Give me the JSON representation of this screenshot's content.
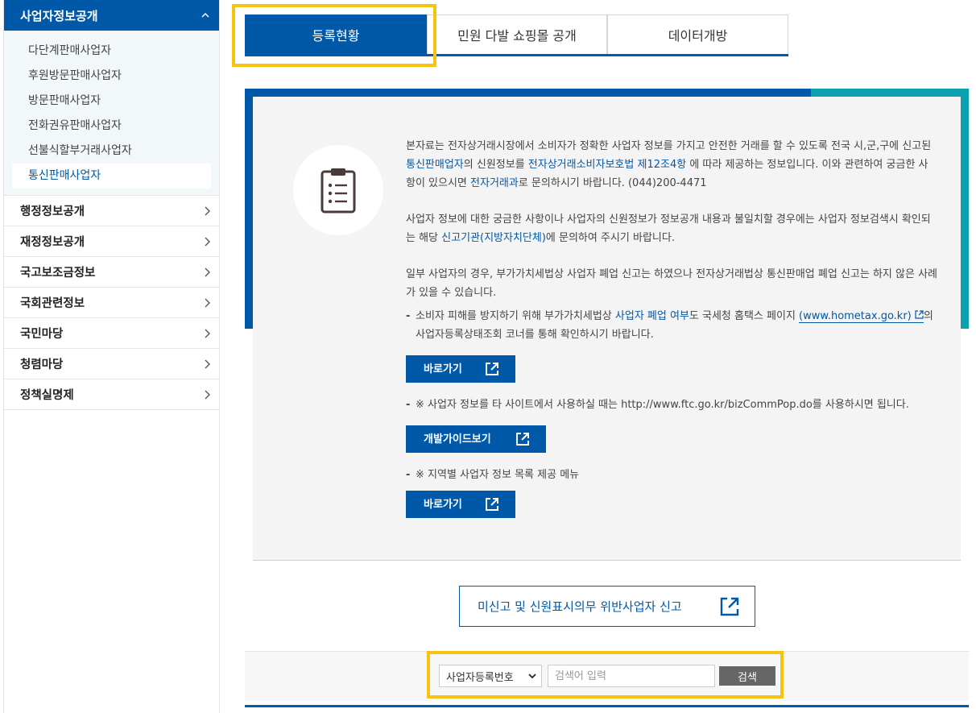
{
  "sidebar": {
    "header": "사업자정보공개",
    "sub_items": [
      {
        "label": "다단계판매사업자"
      },
      {
        "label": "후원방문판매사업자"
      },
      {
        "label": "방문판매사업자"
      },
      {
        "label": "전화권유판매사업자"
      },
      {
        "label": "선불식할부거래사업자"
      },
      {
        "label": "통신판매사업자"
      }
    ],
    "items": [
      {
        "label": "행정정보공개"
      },
      {
        "label": "재정정보공개"
      },
      {
        "label": "국고보조금정보"
      },
      {
        "label": "국회관련정보"
      },
      {
        "label": "국민마당"
      },
      {
        "label": "청렴마당"
      },
      {
        "label": "정책실명제"
      }
    ]
  },
  "tabs": [
    {
      "label": "등록현황"
    },
    {
      "label": "민원 다발 쇼핑몰 공개"
    },
    {
      "label": "데이터개방"
    }
  ],
  "info": {
    "p1_a": "본자료는 전자상거래시장에서 소비자가 정확한 사업자 정보를 가지고 안전한 거래를 할 수 있도록 전국 시,군,구에 신고된 ",
    "p1_link1": "통신판매업자",
    "p1_b": "의 신원정보를 ",
    "p1_link2": "전자상거래소비자보호법 제12조4항",
    "p1_c": " 에 따라 제공하는 정보입니다. 이와 관련하여 궁금한 사항이 있으시면 ",
    "p1_link3": "전자거래과",
    "p1_d": "로 문의하시기 바랍니다. (044)200-4471",
    "p2_a": "사업자 정보에 대한 궁금한 사항이나 사업자의 신원정보가 정보공개 내용과 불일치할 경우에는 사업자 정보검색시 확인되는 해당 ",
    "p2_link": "신고기관(지방자치단체)",
    "p2_b": "에 문의하여 주시기 바랍니다.",
    "p3": "일부 사업자의 경우, 부가가치세법상 사업자 폐업 신고는 하였으나 전자상거래법상 통신판매업 폐업 신고는 하지 않은 사례가 있을 수 있습니다.",
    "b1_a": "소비자 피해를 방지하기 위해 부가가치세법상 ",
    "b1_link": "사업자 폐업 여부",
    "b1_b": "도 국세청 홈택스 페이지 ",
    "b1_ext": "(www.hometax.go.kr)",
    "b1_c": "의 사업자등록상태조회 코너를 통해 확인하시기 바랍니다.",
    "btn1": "바로가기",
    "b2": "※ 사업자 정보를 타 사이트에서 사용하실 때는 http://www.ftc.go.kr/bizCommPop.do를 사용하시면 됩니다.",
    "btn2": "개발가이드보기",
    "b3": "※ 지역별 사업자 정보 목록 제공 메뉴",
    "btn3": "바로가기"
  },
  "report_button": "미신고 및 신원표시의무 위반사업자 신고",
  "search": {
    "select_value": "사업자등록번호",
    "placeholder": "검색어 입력",
    "button": "검색"
  },
  "colors": {
    "primary": "#0058a8",
    "teal": "#0aa0ae",
    "highlight": "#f7c311"
  }
}
